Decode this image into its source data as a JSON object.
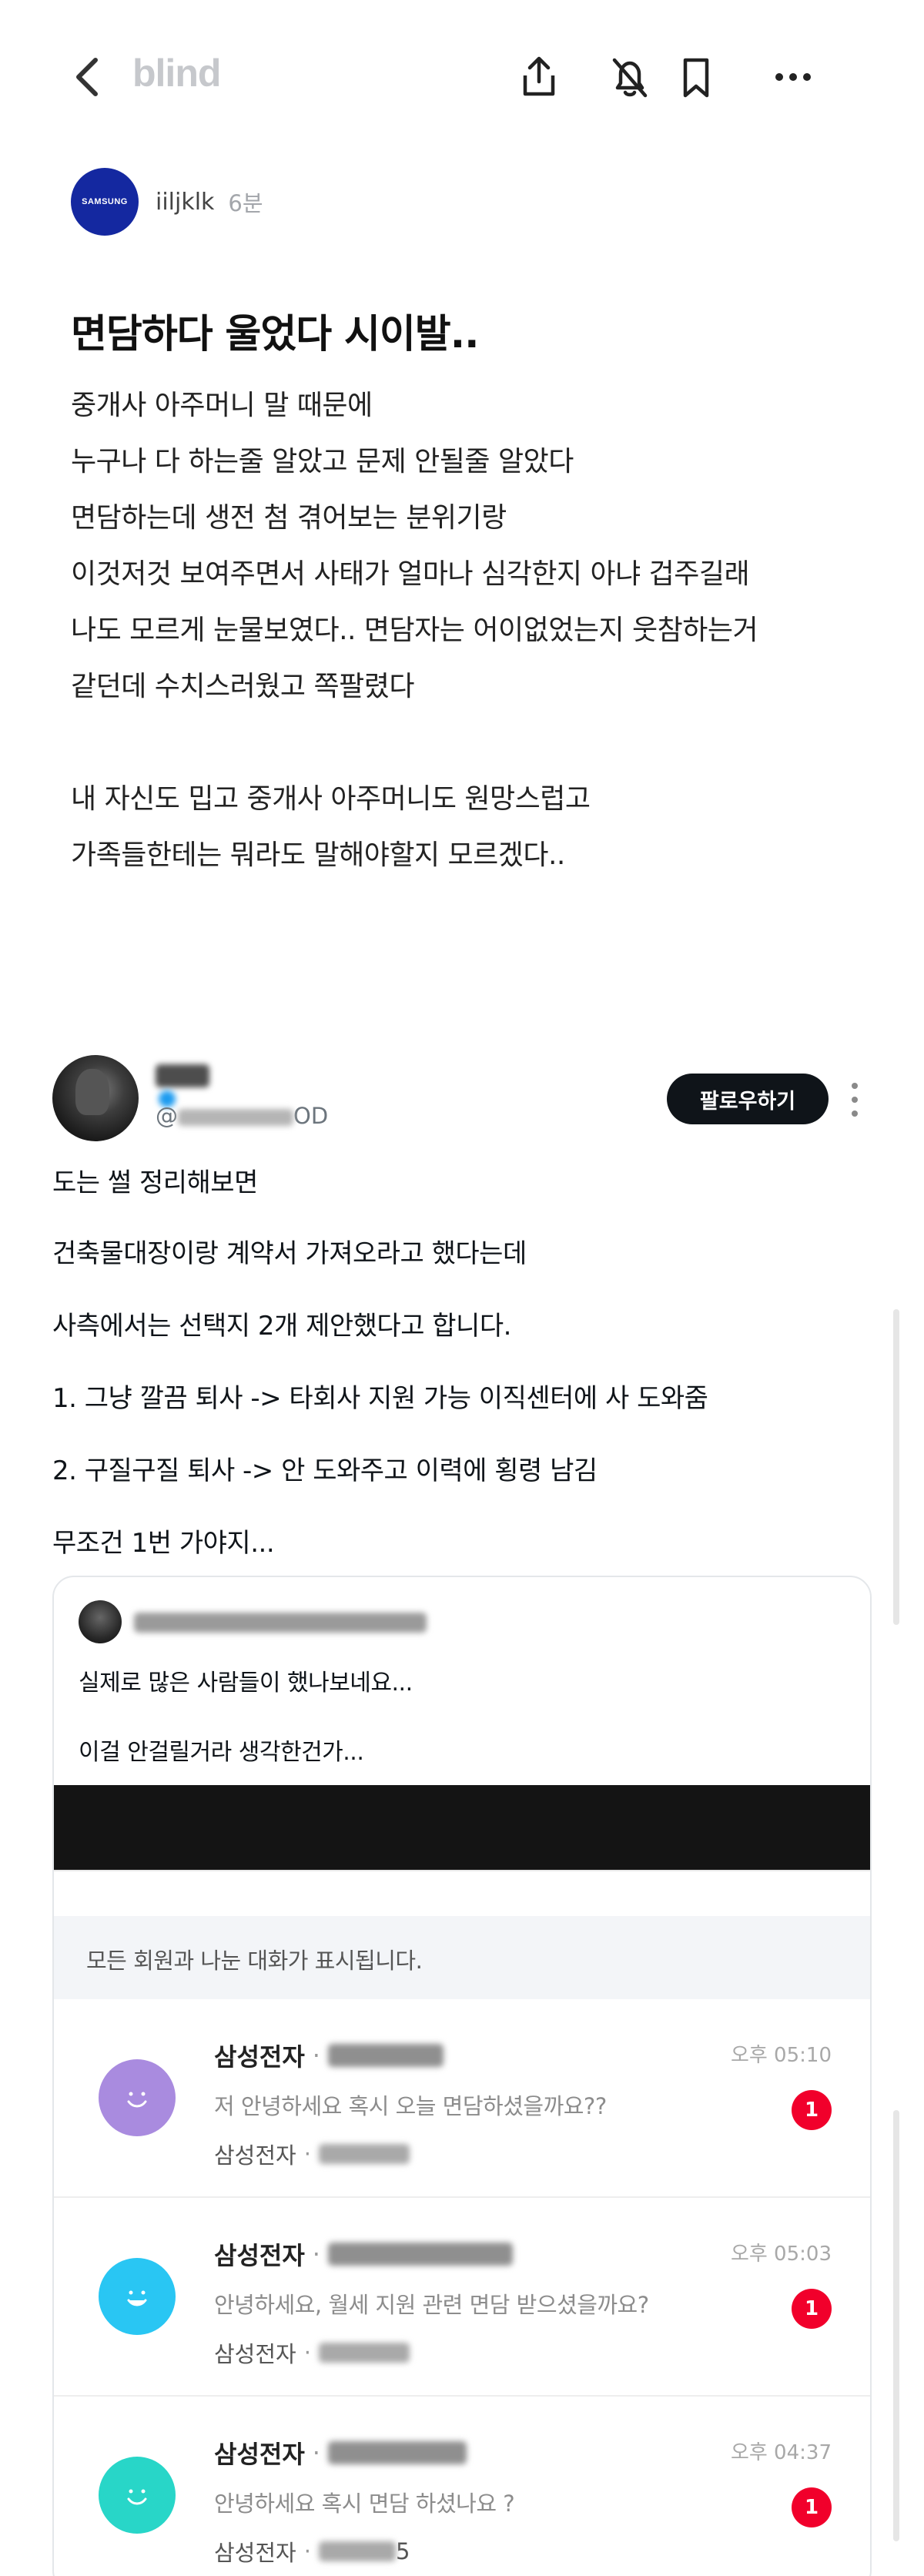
{
  "app": {
    "logo_text": "blind"
  },
  "header_icons": [
    "back-icon",
    "share-icon",
    "notification-off-icon",
    "bookmark-icon",
    "more-horizontal-icon"
  ],
  "author": {
    "company_logo_text": "SAMSUNG",
    "name": "iiljklk",
    "time": "6분"
  },
  "post": {
    "title": "면담하다 울었다 시이발..",
    "body_lines": [
      "중개사 아주머니 말 때문에",
      "누구나 다 하는줄 알았고 문제 안될줄 알았다",
      "면담하는데 생전 첨 겪어보는 분위기랑",
      "이것저것 보여주면서 사태가 얼마나 심각한지 아냐 겁주길래",
      "나도 모르게 눈물보였다.. 면담자는 어이없었는지 웃참하는거",
      "같던데 수치스러웠고 쪽팔렸다",
      "",
      "내 자신도 밉고 중개사 아주머니도 원망스럽고",
      "가족들한테는 뭐라도 말해야할지 모르겠다.."
    ]
  },
  "tweet": {
    "handle_prefix": "@",
    "handle_suffix": "OD",
    "follow_label": "팔로우하기",
    "lines": [
      "도는 썰 정리해보면",
      "건축물대장이랑 계약서 가져오라고 했다는데",
      "사측에서는 선택지 2개 제안했다고 합니다.",
      "1. 그냥 깔끔 퇴사 -> 타회사 지원 가능 이직센터에 사 도와줌",
      "2. 구질구질 퇴사 -> 안 도와주고 이력에 횡령 남김",
      "무조건 1번 가야지..."
    ],
    "quote": {
      "lines": [
        "실제로 많은 사람들이 했나보네요...",
        "이걸 안걸릴거라 생각한건가..."
      ],
      "chat_notice": "모든 회원과 나눈 대화가 표시됩니다.",
      "messages": [
        {
          "company": "삼성전자",
          "preview": "저 안녕하세요 혹시 오늘 면담하셨을까요??",
          "sub_company": "삼성전자",
          "time": "오후 05:10",
          "badge": "1",
          "avatar_color": "#a98bdf"
        },
        {
          "company": "삼성전자",
          "preview": "안녕하세요, 월세 지원 관련 면담 받으셨을까요?",
          "sub_company": "삼성전자",
          "time": "오후 05:03",
          "badge": "1",
          "avatar_color": "#29c6f3"
        },
        {
          "company": "삼성전자",
          "preview": "안녕하세요 혹시 면담 하셨나요 ?",
          "sub_company": "삼성전자",
          "sub_suffix": "5",
          "time": "오후 04:37",
          "badge": "1",
          "avatar_color": "#28d6c8"
        }
      ]
    }
  }
}
